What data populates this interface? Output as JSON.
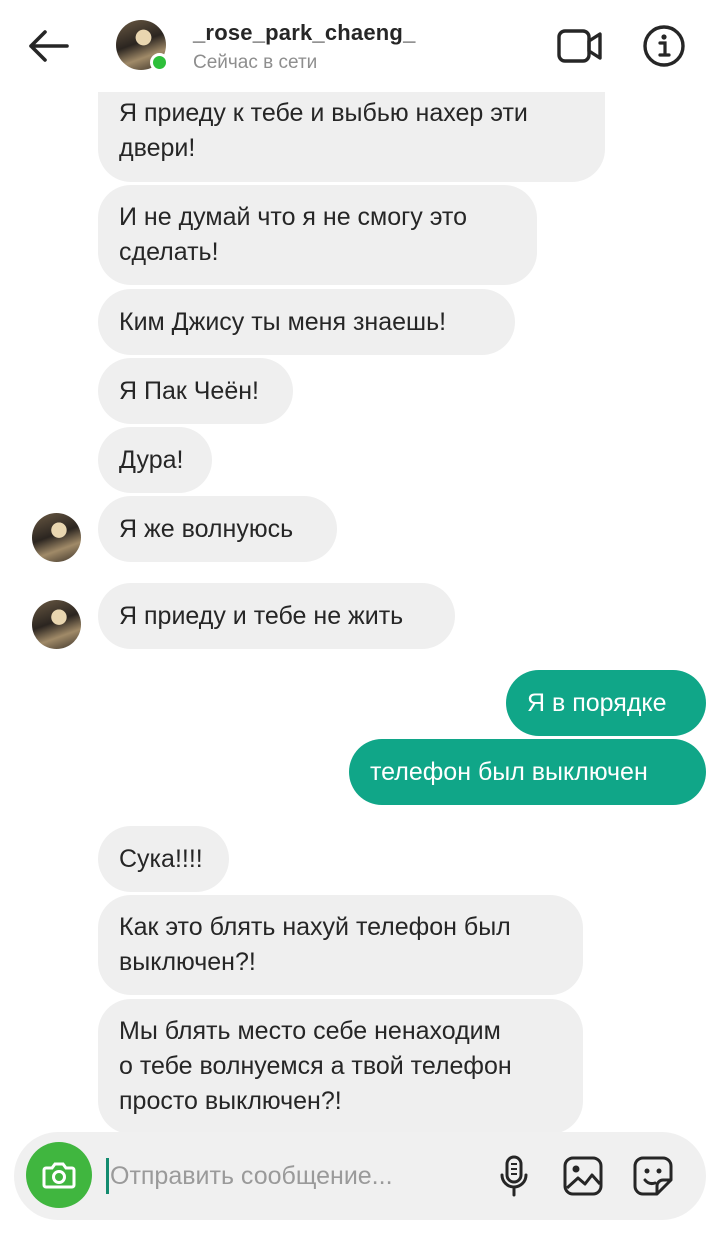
{
  "header": {
    "username": "_rose_park_chaeng_",
    "status": "Сейчас в сети"
  },
  "messages": [
    {
      "side": "in",
      "lines": [
        "Я приеду к тебе и выбью нахер эти",
        "двери!"
      ]
    },
    {
      "side": "in",
      "lines": [
        "И не думай что я не смогу это",
        "сделать!"
      ]
    },
    {
      "side": "in",
      "lines": [
        "Ким Джису ты меня знаешь!"
      ]
    },
    {
      "side": "in",
      "lines": [
        "Я Пак Чеён!"
      ]
    },
    {
      "side": "in",
      "lines": [
        "Дура!"
      ]
    },
    {
      "side": "in",
      "lines": [
        "Я же волнуюсь"
      ],
      "avatar": true
    },
    {
      "side": "in",
      "lines": [
        "Я приеду и тебе не жить"
      ],
      "avatar": true
    },
    {
      "side": "out",
      "lines": [
        "Я в порядке"
      ]
    },
    {
      "side": "out",
      "lines": [
        "телефон был выключен"
      ]
    },
    {
      "side": "in",
      "lines": [
        "Сука!!!!"
      ]
    },
    {
      "side": "in",
      "lines": [
        "Как это блять нахуй телефон был",
        "выключен?!"
      ]
    },
    {
      "side": "in",
      "lines": [
        "Мы блять место себе ненаходим",
        "о тебе волнуемся а твой телефон",
        "просто выключен?!"
      ]
    }
  ],
  "composer": {
    "placeholder": "Отправить сообщение..."
  },
  "colors": {
    "outgoing_bubble": "#10a688",
    "incoming_bubble": "#efefef",
    "online_dot": "#2dbf3a",
    "camera_button": "#40b63f"
  },
  "icons": [
    "back-arrow-icon",
    "video-camera-icon",
    "info-icon",
    "camera-icon",
    "microphone-icon",
    "gallery-icon",
    "sticker-icon"
  ]
}
